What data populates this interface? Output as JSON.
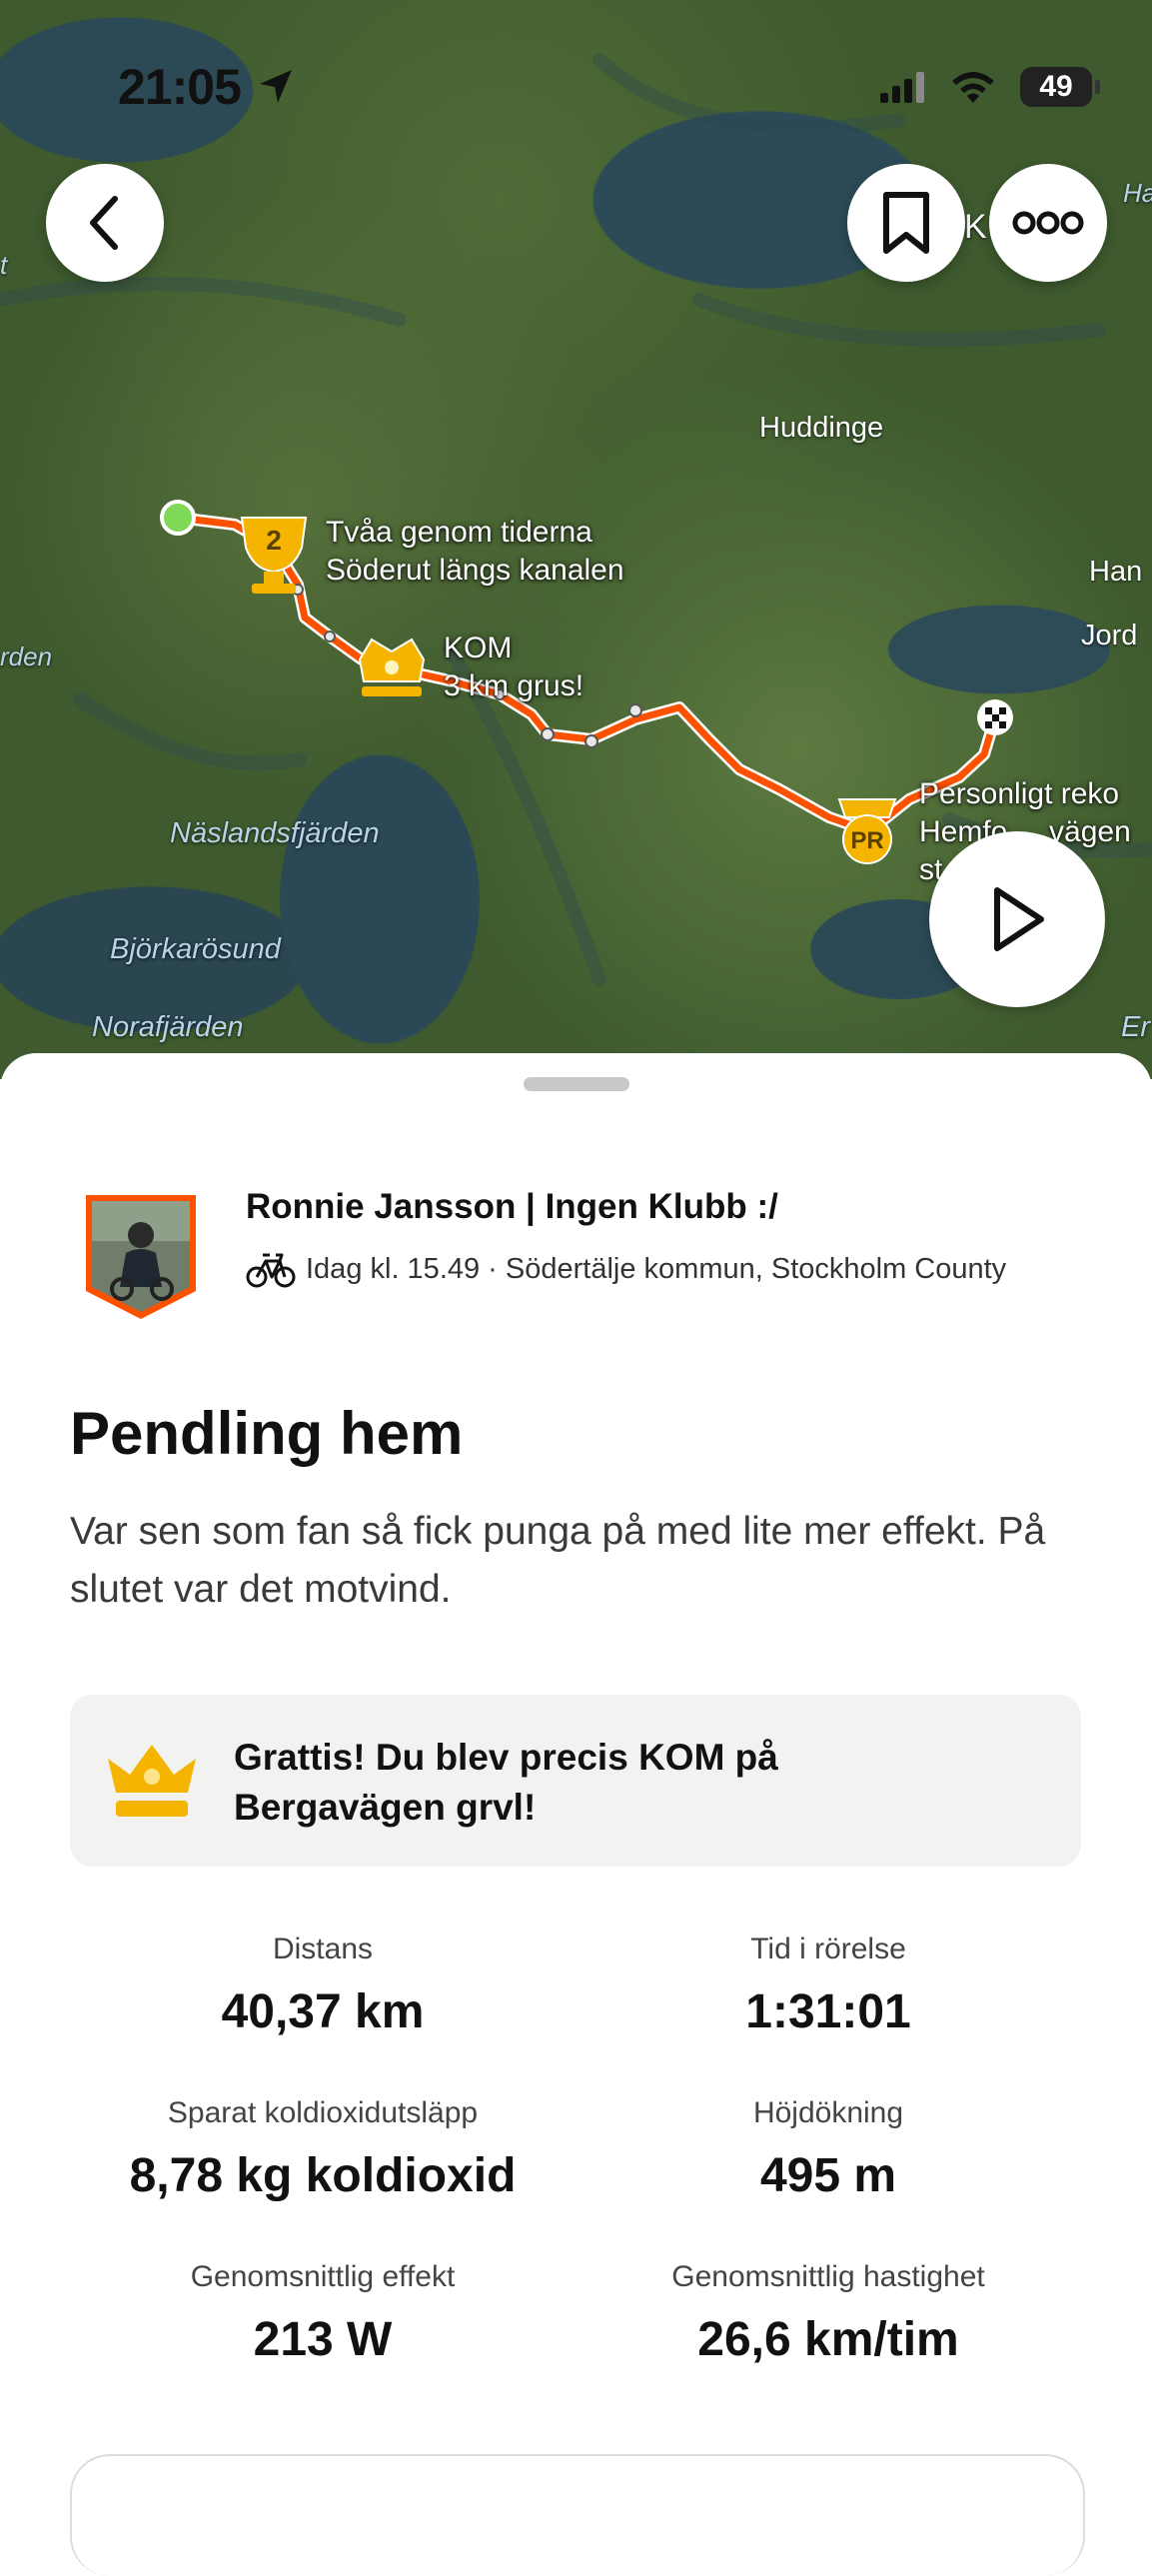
{
  "status_bar": {
    "time": "21:05",
    "battery": "49"
  },
  "map": {
    "labels": {
      "huddinge": "Huddinge",
      "naslandsfjarden": "Näslandsfjärden",
      "bjorkarosund": "Björkarösund",
      "norafjarden": "Norafjärden",
      "edge_ha": "Ha",
      "edge_han": "Han",
      "edge_jord": "Jord",
      "edge_en": "Er",
      "edge_rden": "rden",
      "edge_t": "t",
      "edge_k": "K"
    },
    "markers": {
      "second_place": {
        "badge": "2",
        "line1": "Tvåa genom tiderna",
        "line2": "Söderut längs kanalen"
      },
      "kom": {
        "line1": "KOM",
        "line2": "3 km grus!"
      },
      "pr": {
        "badge": "PR",
        "line1": "Personligt reko",
        "line2": "Hemfo     vägen",
        "line3": "st"
      }
    },
    "route_color": "#fc5200"
  },
  "activity": {
    "athlete_name": "Ronnie Jansson | Ingen Klubb :/",
    "meta": "Idag kl. 15.49 · Södertälje kommun, Stockholm County",
    "title": "Pendling hem",
    "description": "Var sen som fan så fick punga på med lite mer effekt. På slutet var det motvind.",
    "kom_banner": "Grattis! Du blev precis KOM på Bergavägen grvl!",
    "stats": [
      {
        "label": "Distans",
        "value": "40,37 km"
      },
      {
        "label": "Tid i rörelse",
        "value": "1:31:01"
      },
      {
        "label": "Sparat koldioxidutsläpp",
        "value": "8,78 kg koldioxid"
      },
      {
        "label": "Höjdökning",
        "value": "495 m"
      },
      {
        "label": "Genomsnittlig effekt",
        "value": "213 W"
      },
      {
        "label": "Genomsnittlig hastighet",
        "value": "26,6 km/tim"
      }
    ]
  },
  "colors": {
    "accent": "#fc5200",
    "gold": "#f5b400",
    "start": "#7ed957"
  }
}
